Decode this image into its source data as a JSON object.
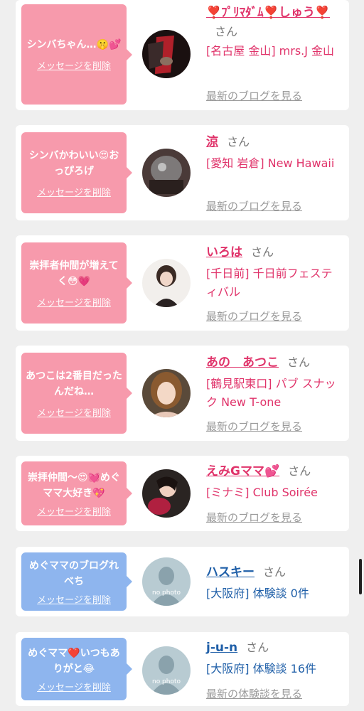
{
  "cards": [
    {
      "bubble_color": "#f79aac",
      "message": "シンバちゃん…🤫💕",
      "delete_label": "メッセージを削除",
      "name": "❣️ﾌﾟﾘﾏﾀﾞﾑ❣️しゅう❣️",
      "honorific": "さん",
      "shop": "[名古屋 金山] mrs.J 金山",
      "link": "最新のブログを見る"
    },
    {
      "bubble_color": "#f79aac",
      "message": "シンバかわいい😍おっぴろげ",
      "delete_label": "メッセージを削除",
      "name": "涼",
      "honorific": "さん",
      "shop": "[愛知 岩倉] New Hawaii",
      "link": "最新のブログを見る"
    },
    {
      "bubble_color": "#f79aac",
      "message": "崇拝者仲間が増えてく😳💗",
      "delete_label": "メッセージを削除",
      "name": "いろは",
      "honorific": "さん",
      "shop": "[千日前] 千日前フェスティバル",
      "link": "最新のブログを見る"
    },
    {
      "bubble_color": "#f79aac",
      "message": "あつこは2番目だったんだね…",
      "delete_label": "メッセージを削除",
      "name": "あの　あつこ",
      "honorific": "さん",
      "shop": "[鶴見駅東口] パブ スナック New T-one",
      "link": "最新のブログを見る"
    },
    {
      "bubble_color": "#f79aac",
      "message": "崇拝仲間〜😍💓めぐママ大好き💖",
      "delete_label": "メッセージを削除",
      "name": "えみGママ💕",
      "honorific": "さん",
      "shop": "[ミナミ] Club Soirée",
      "link": "最新のブログを見る"
    },
    {
      "bubble_color": "#8eb5ee",
      "message": "めぐママのブログれべち",
      "delete_label": "メッセージを削除",
      "name": "ハスキー",
      "honorific": "さん",
      "shop": "[大阪府] 体験談 0件",
      "link": ""
    },
    {
      "bubble_color": "#8eb5ee",
      "message": "めぐママ❤️いつもありがと😂",
      "delete_label": "メッセージを削除",
      "name": "j-u-n",
      "honorific": "さん",
      "shop": "[大阪府] 体験談 16件",
      "link": "最新の体験談を見る"
    }
  ],
  "avatars": {
    "no_photo_label": "no photo"
  }
}
